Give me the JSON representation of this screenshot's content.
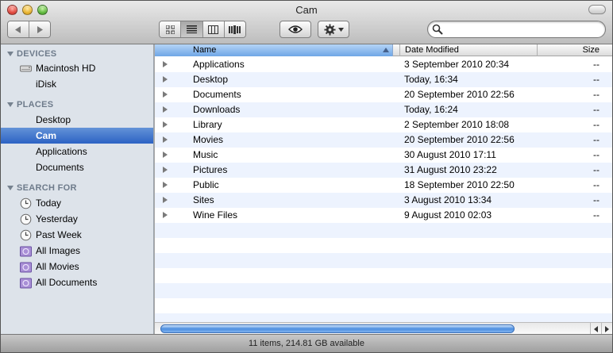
{
  "window": {
    "title": "Cam"
  },
  "toolbar": {
    "back_icon": "chevron-left-icon",
    "forward_icon": "chevron-right-icon",
    "view_modes": [
      "icon-view",
      "list-view",
      "column-view",
      "coverflow-view"
    ],
    "selected_view": "list-view",
    "quicklook_icon": "eye-icon",
    "action_icon": "gear-icon",
    "search": {
      "value": "",
      "placeholder": ""
    }
  },
  "sidebar": {
    "devices": {
      "heading": "DEVICES",
      "items": [
        {
          "label": "Macintosh HD",
          "icon": "hard-drive-icon"
        },
        {
          "label": "iDisk",
          "icon": "idisk-icon"
        }
      ]
    },
    "places": {
      "heading": "PLACES",
      "items": [
        {
          "label": "Desktop"
        },
        {
          "label": "Cam",
          "selected": true
        },
        {
          "label": "Applications"
        },
        {
          "label": "Documents"
        }
      ]
    },
    "search_for": {
      "heading": "SEARCH FOR",
      "items": [
        {
          "label": "Today",
          "icon": "clock-icon"
        },
        {
          "label": "Yesterday",
          "icon": "clock-icon"
        },
        {
          "label": "Past Week",
          "icon": "clock-icon"
        },
        {
          "label": "All Images",
          "icon": "smart-folder-icon"
        },
        {
          "label": "All Movies",
          "icon": "smart-folder-icon"
        },
        {
          "label": "All Documents",
          "icon": "smart-folder-icon"
        }
      ]
    }
  },
  "list": {
    "columns": {
      "name": "Name",
      "date": "Date Modified",
      "size": "Size"
    },
    "rows": [
      {
        "name": "Applications",
        "date": "3 September 2010 20:34",
        "size": "--"
      },
      {
        "name": "Desktop",
        "date": "Today, 16:34",
        "size": "--"
      },
      {
        "name": "Documents",
        "date": "20 September 2010 22:56",
        "size": "--"
      },
      {
        "name": "Downloads",
        "date": "Today, 16:24",
        "size": "--"
      },
      {
        "name": "Library",
        "date": "2 September 2010 18:08",
        "size": "--"
      },
      {
        "name": "Movies",
        "date": "20 September 2010 22:56",
        "size": "--"
      },
      {
        "name": "Music",
        "date": "30 August 2010 17:11",
        "size": "--"
      },
      {
        "name": "Pictures",
        "date": "31 August 2010 23:22",
        "size": "--"
      },
      {
        "name": "Public",
        "date": "18 September 2010 22:50",
        "size": "--"
      },
      {
        "name": "Sites",
        "date": "3 August 2010 13:34",
        "size": "--"
      },
      {
        "name": "Wine Files",
        "date": "9 August 2010 02:03",
        "size": "--"
      }
    ]
  },
  "status": {
    "text": "11 items, 214.81 GB available"
  },
  "colors": {
    "selection": "#3a6fcf",
    "sidebar_bg": "#dde3ea",
    "row_alt": "#edf3fe"
  }
}
